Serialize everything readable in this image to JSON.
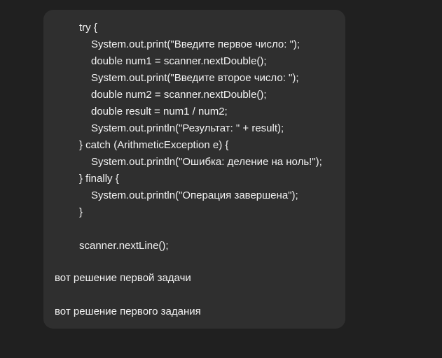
{
  "message": {
    "code_lines": [
      {
        "text": "try {",
        "indent": 0
      },
      {
        "text": "System.out.print(\"Введите первое число: \");",
        "indent": 1
      },
      {
        "text": "double num1 = scanner.nextDouble();",
        "indent": 1
      },
      {
        "text": "System.out.print(\"Введите второе число: \");",
        "indent": 1
      },
      {
        "text": "double num2 = scanner.nextDouble();",
        "indent": 1
      },
      {
        "text": "double result = num1 / num2;",
        "indent": 1
      },
      {
        "text": "System.out.println(\"Результат: \" + result);",
        "indent": 1
      },
      {
        "text": "} catch (ArithmeticException e) {",
        "indent": 0
      },
      {
        "text": "System.out.println(\"Ошибка: деление на ноль!\");",
        "indent": 1
      },
      {
        "text": "} finally {",
        "indent": 0
      },
      {
        "text": "System.out.println(\"Операция завершена\");",
        "indent": 1
      },
      {
        "text": "}",
        "indent": 0
      },
      {
        "text": "",
        "indent": 0
      },
      {
        "text": "scanner.nextLine();",
        "indent": 0
      }
    ],
    "text_1": "вот решение первой задачи",
    "text_2": "вот решение первого задания"
  }
}
